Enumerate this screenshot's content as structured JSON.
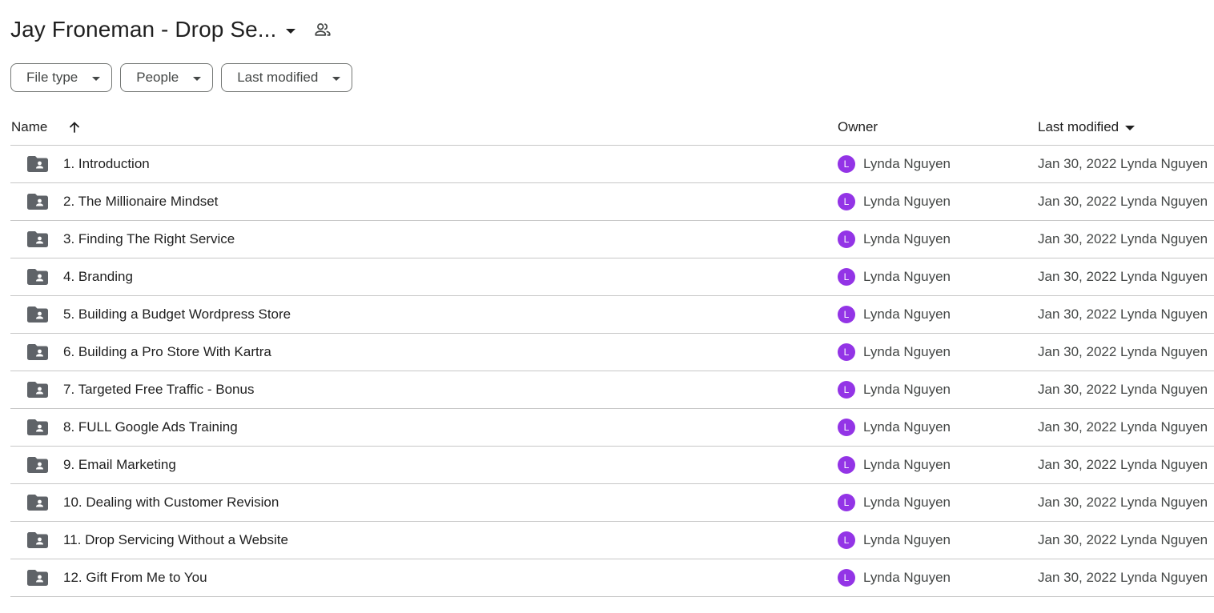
{
  "header": {
    "title": "Jay Froneman - Drop Se...",
    "title_caret_icon": "caret-down-icon",
    "share_icon": "people-icon"
  },
  "filters": [
    {
      "label": "File type"
    },
    {
      "label": "People"
    },
    {
      "label": "Last modified"
    }
  ],
  "columns": {
    "name": "Name",
    "owner": "Owner",
    "last_modified": "Last modified"
  },
  "rows": [
    {
      "name": "1. Introduction",
      "owner": "Lynda Nguyen",
      "avatar": "L",
      "modified": "Jan 30, 2022 Lynda Nguyen"
    },
    {
      "name": "2. The Millionaire Mindset",
      "owner": "Lynda Nguyen",
      "avatar": "L",
      "modified": "Jan 30, 2022 Lynda Nguyen"
    },
    {
      "name": "3. Finding The Right Service",
      "owner": "Lynda Nguyen",
      "avatar": "L",
      "modified": "Jan 30, 2022 Lynda Nguyen"
    },
    {
      "name": "4. Branding",
      "owner": "Lynda Nguyen",
      "avatar": "L",
      "modified": "Jan 30, 2022 Lynda Nguyen"
    },
    {
      "name": "5. Building a Budget Wordpress Store",
      "owner": "Lynda Nguyen",
      "avatar": "L",
      "modified": "Jan 30, 2022 Lynda Nguyen"
    },
    {
      "name": "6. Building a Pro Store With Kartra",
      "owner": "Lynda Nguyen",
      "avatar": "L",
      "modified": "Jan 30, 2022 Lynda Nguyen"
    },
    {
      "name": "7. Targeted Free Traffic - Bonus",
      "owner": "Lynda Nguyen",
      "avatar": "L",
      "modified": "Jan 30, 2022 Lynda Nguyen"
    },
    {
      "name": "8. FULL Google Ads Training",
      "owner": "Lynda Nguyen",
      "avatar": "L",
      "modified": "Jan 30, 2022 Lynda Nguyen"
    },
    {
      "name": "9. Email Marketing",
      "owner": "Lynda Nguyen",
      "avatar": "L",
      "modified": "Jan 30, 2022 Lynda Nguyen"
    },
    {
      "name": "10. Dealing with Customer Revision",
      "owner": "Lynda Nguyen",
      "avatar": "L",
      "modified": "Jan 30, 2022 Lynda Nguyen"
    },
    {
      "name": "11. Drop Servicing Without a Website",
      "owner": "Lynda Nguyen",
      "avatar": "L",
      "modified": "Jan 30, 2022 Lynda Nguyen"
    },
    {
      "name": "12. Gift From Me to You",
      "owner": "Lynda Nguyen",
      "avatar": "L",
      "modified": "Jan 30, 2022 Lynda Nguyen"
    }
  ],
  "colors": {
    "avatar": "#9334e6",
    "folder": "#5f6368",
    "divider": "#c7c7c7"
  }
}
